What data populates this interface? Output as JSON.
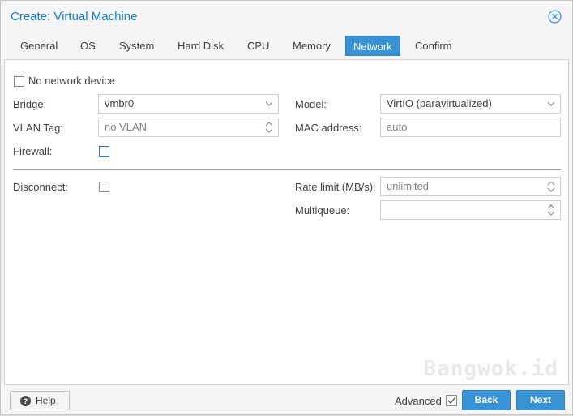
{
  "dialog": {
    "title": "Create: Virtual Machine"
  },
  "tabs": [
    {
      "label": "General"
    },
    {
      "label": "OS"
    },
    {
      "label": "System"
    },
    {
      "label": "Hard Disk"
    },
    {
      "label": "CPU"
    },
    {
      "label": "Memory"
    },
    {
      "label": "Network",
      "active": true
    },
    {
      "label": "Confirm"
    }
  ],
  "form": {
    "no_network_device": {
      "label": "No network device",
      "checked": false
    },
    "bridge": {
      "label": "Bridge:",
      "value": "vmbr0"
    },
    "vlan_tag": {
      "label": "VLAN Tag:",
      "placeholder": "no VLAN"
    },
    "firewall": {
      "label": "Firewall:",
      "checked": false
    },
    "model": {
      "label": "Model:",
      "value": "VirtIO (paravirtualized)"
    },
    "mac_address": {
      "label": "MAC address:",
      "placeholder": "auto"
    },
    "disconnect": {
      "label": "Disconnect:",
      "checked": false
    },
    "rate_limit": {
      "label": "Rate limit (MB/s):",
      "placeholder": "unlimited"
    },
    "multiqueue": {
      "label": "Multiqueue:",
      "value": ""
    }
  },
  "watermark": "Bangwok.id",
  "footer": {
    "help_label": "Help",
    "advanced_label": "Advanced",
    "advanced_checked": true,
    "back_label": "Back",
    "next_label": "Next"
  },
  "colors": {
    "accent": "#3892d4",
    "title": "#157fcc"
  }
}
